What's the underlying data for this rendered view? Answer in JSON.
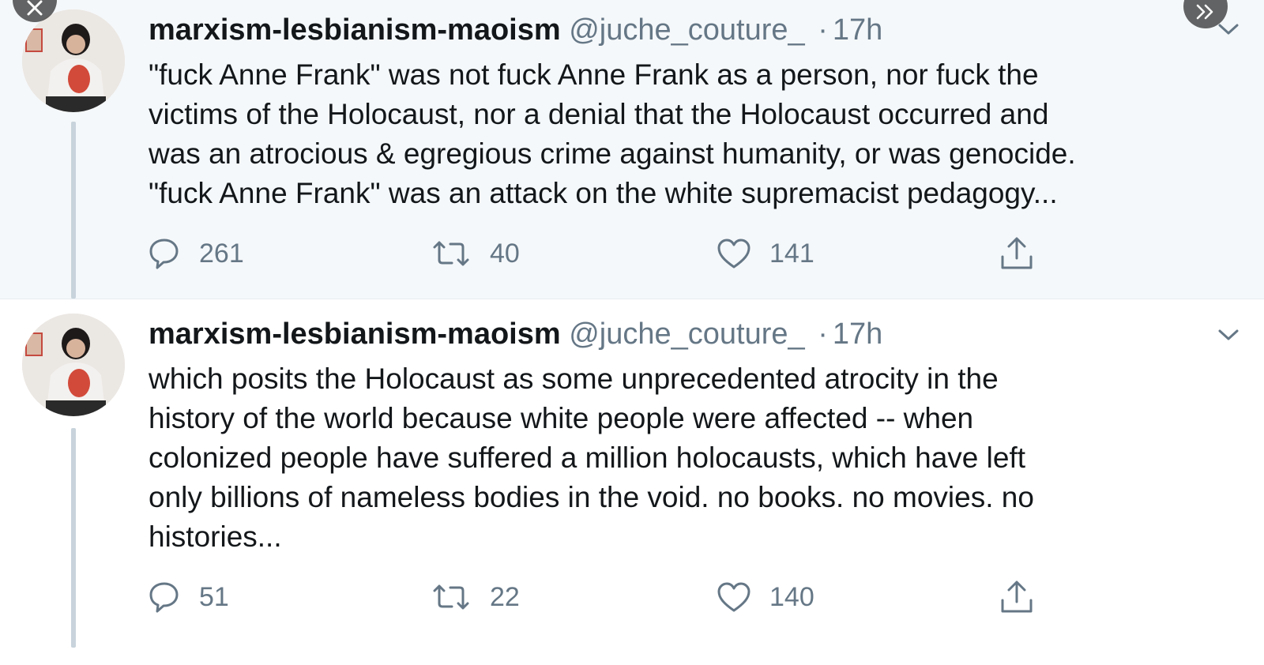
{
  "tweets": [
    {
      "author_name": "marxism-lesbianism-maoism",
      "handle": "@juche_couture_",
      "separator": "·",
      "time": "17h",
      "text": "\"fuck Anne Frank\" was not fuck Anne Frank as a person, nor fuck the\nvictims of the Holocaust, nor a denial that the Holocaust occurred and\nwas an atrocious & egregious crime against humanity, or was genocide.\n\"fuck Anne Frank\" was an attack on the white supremacist pedagogy...",
      "replies": "261",
      "retweets": "40",
      "likes": "141"
    },
    {
      "author_name": "marxism-lesbianism-maoism",
      "handle": "@juche_couture_",
      "separator": "·",
      "time": "17h",
      "text": "which posits the Holocaust as some unprecedented atrocity in the\nhistory of the world because white people were affected -- when\ncolonized people have suffered a million holocausts, which have left\nonly billions of nameless bodies in the void. no books. no movies. no\nhistories...",
      "replies": "51",
      "retweets": "22",
      "likes": "140"
    }
  ],
  "icons": {
    "reply": "reply-icon",
    "retweet": "retweet-icon",
    "like": "heart-icon",
    "share": "share-icon",
    "caret": "chevron-down-icon",
    "close": "close-icon",
    "next": "double-chevron-right-icon"
  },
  "colors": {
    "thread_bg": "#f5f8fa",
    "secondary_text": "#657786",
    "thread_line": "#c8d3db"
  }
}
